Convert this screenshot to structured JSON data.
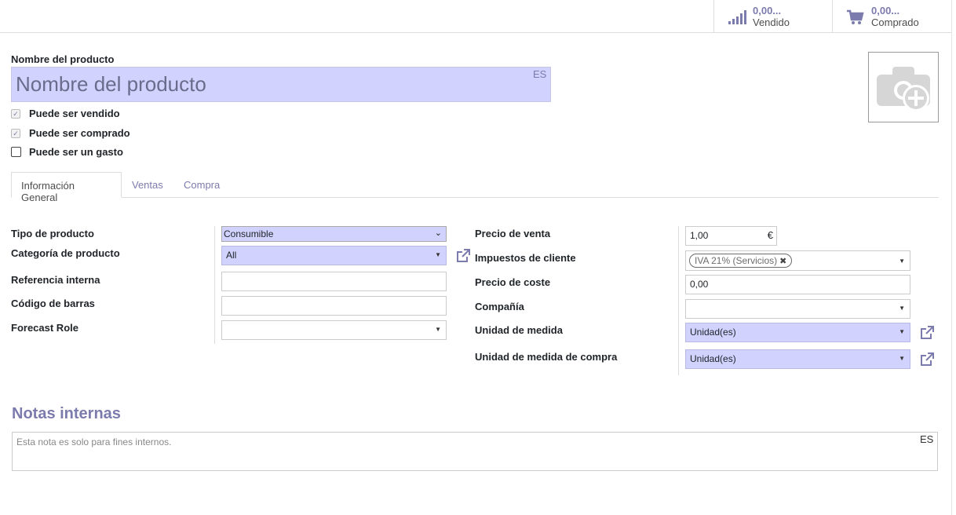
{
  "stats": {
    "sold": {
      "value": "0,00...",
      "label": "Vendido",
      "icon": "bar-chart-icon"
    },
    "purchased": {
      "value": "0,00...",
      "label": "Comprado",
      "icon": "shopping-cart-icon"
    }
  },
  "product": {
    "name_label": "Nombre del producto",
    "name_placeholder": "Nombre del producto",
    "name_lang": "ES",
    "checkboxes": [
      {
        "label": "Puede ser vendido",
        "checked": true
      },
      {
        "label": "Puede ser comprado",
        "checked": true
      },
      {
        "label": "Puede ser un gasto",
        "checked": false
      }
    ]
  },
  "tabs": [
    {
      "label": "Información General",
      "active": true
    },
    {
      "label": "Ventas",
      "active": false
    },
    {
      "label": "Compra",
      "active": false
    }
  ],
  "left_fields": {
    "product_type": {
      "label": "Tipo de producto",
      "value": "Consumible"
    },
    "category": {
      "label": "Categoría de producto",
      "value": "All"
    },
    "internal_ref": {
      "label": "Referencia interna",
      "value": ""
    },
    "barcode": {
      "label": "Código de barras",
      "value": ""
    },
    "forecast_role": {
      "label": "Forecast Role",
      "value": ""
    }
  },
  "right_fields": {
    "sale_price": {
      "label": "Precio de venta",
      "value": "1,00",
      "currency": "€"
    },
    "customer_taxes": {
      "label": "Impuestos de cliente",
      "tag": "IVA 21% (Servicios)"
    },
    "cost": {
      "label": "Precio de coste",
      "value": "0,00"
    },
    "company": {
      "label": "Compañía",
      "value": ""
    },
    "uom": {
      "label": "Unidad de medida",
      "value": "Unidad(es)"
    },
    "uom_po": {
      "label": "Unidad de medida de compra",
      "value": "Unidad(es)"
    }
  },
  "notes": {
    "title": "Notas internas",
    "placeholder": "Esta nota es solo para fines internos.",
    "lang": "ES"
  },
  "colors": {
    "accent": "#7c7bad",
    "required_bg": "#d2d2ff"
  }
}
